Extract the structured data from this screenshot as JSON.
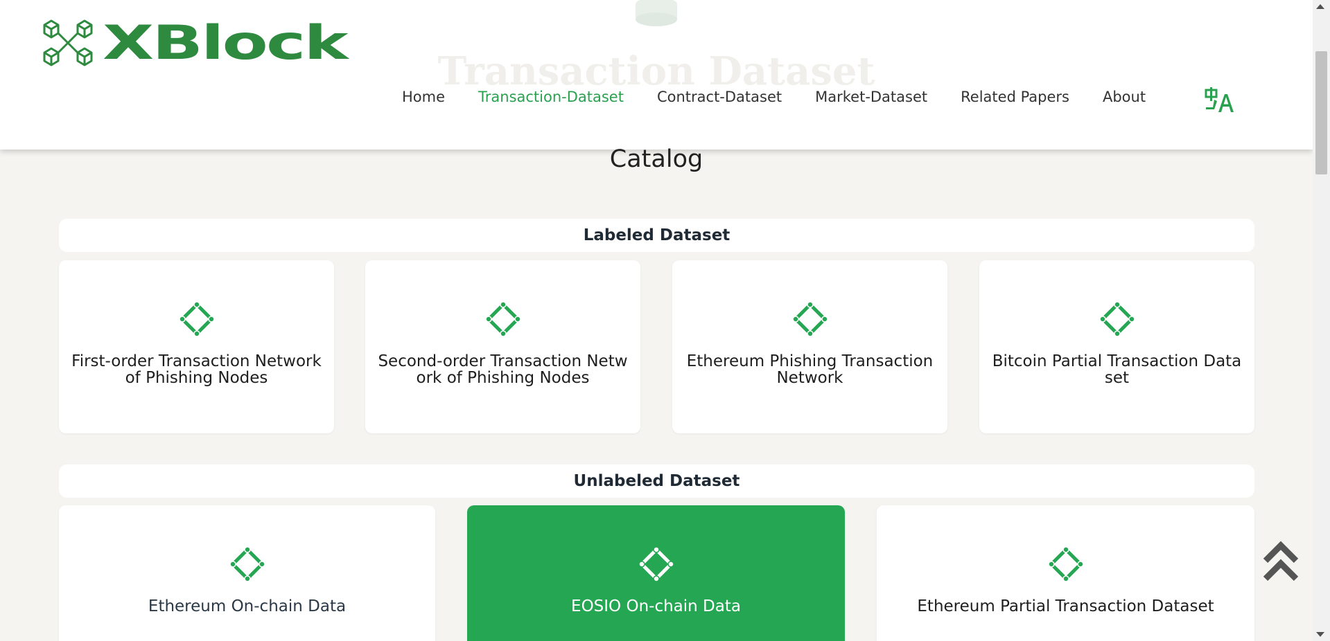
{
  "hero": {
    "title": "Transaction Dataset"
  },
  "header": {
    "logo_text": "XBlock",
    "nav": [
      {
        "label": "Home"
      },
      {
        "label": "Transaction-Dataset",
        "active": true
      },
      {
        "label": "Contract-Dataset"
      },
      {
        "label": "Market-Dataset"
      },
      {
        "label": "Related Papers"
      },
      {
        "label": "About"
      }
    ],
    "language_icon": "translate-icon"
  },
  "catalog": {
    "title": "Catalog",
    "labeled": {
      "heading": "Labeled Dataset",
      "cards": [
        {
          "label": "First-order Transaction Network of Phishing Nodes"
        },
        {
          "label": "Second-order Transaction Network of Phishing Nodes"
        },
        {
          "label": "Ethereum Phishing Transaction Network"
        },
        {
          "label": "Bitcoin Partial Transaction Dataset"
        }
      ]
    },
    "unlabeled": {
      "heading": "Unlabeled Dataset",
      "cards": [
        {
          "label": "Ethereum On-chain Data"
        },
        {
          "label": "EOSIO On-chain Data",
          "highlighted": true
        },
        {
          "label": "Ethereum Partial Transaction Dataset"
        }
      ]
    }
  },
  "colors": {
    "brand_green": "#2d8a3e",
    "accent_green": "#24a652",
    "background": "#f5f4f1"
  }
}
